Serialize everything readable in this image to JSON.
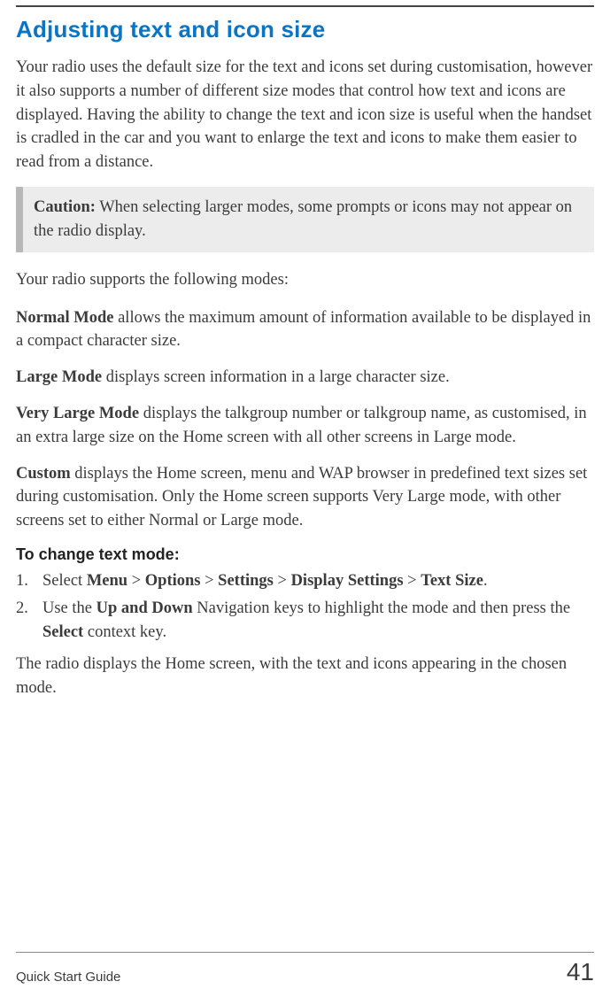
{
  "heading": "Adjusting text and icon size",
  "intro": "Your radio uses the default size for the text and icons set during customisation, however it also supports a number of different size modes that control how text and icons are displayed. Having the ability to change the text and icon size is useful when the handset is cradled in the car and you want to enlarge the text and icons to make them easier to read from a distance.",
  "caution_label": "Caution:",
  "caution_text": "When selecting larger modes, some prompts or icons may not appear on the radio display.",
  "supports_lead": "Your radio supports the following modes:",
  "modes": {
    "normal": {
      "name": "Normal Mode",
      "desc": " allows the maximum amount of information available to be displayed in a compact character size."
    },
    "large": {
      "name": "Large Mode",
      "desc": " displays screen information in a large character size."
    },
    "very_large": {
      "name": "Very Large Mode",
      "desc": " displays the talkgroup number or talkgroup name, as customised, in an extra large size on the Home screen with all other screens in Large mode."
    },
    "custom": {
      "name": "Custom",
      "desc": " displays the Home screen, menu and WAP browser in predefined text sizes set during customisation. Only the Home screen supports Very Large mode, with other screens set to either Normal or Large mode."
    }
  },
  "change_head": "To change text mode:",
  "steps": {
    "s1_prefix": "Select ",
    "s1_menu": "Menu",
    "s1_gt1": " > ",
    "s1_options": "Options",
    "s1_gt2": " > ",
    "s1_settings": "Settings",
    "s1_gt3": " > ",
    "s1_display": "Display Settings",
    "s1_gt4": " > ",
    "s1_textsize": "Text Size",
    "s1_end": ".",
    "s2_prefix": "Use the ",
    "s2_updown": "Up and Down",
    "s2_mid": " Navigation keys to highlight the mode and then press the ",
    "s2_select": "Select",
    "s2_end": " context key."
  },
  "result": "The radio displays the Home screen, with the text and icons appearing in the chosen mode.",
  "footer_guide": "Quick Start Guide",
  "footer_page": "41"
}
